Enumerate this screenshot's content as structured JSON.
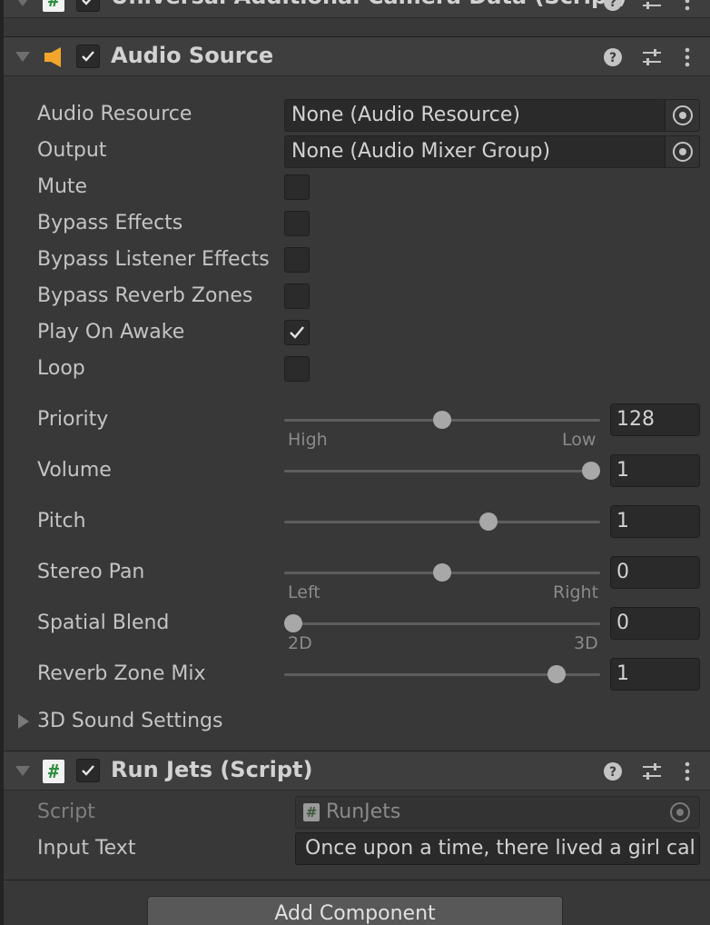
{
  "top_component": {
    "title": "Universal Additional Camera Data (Script)"
  },
  "audio_source": {
    "title": "Audio Source",
    "enabled": true,
    "fields": {
      "audio_resource": {
        "label": "Audio Resource",
        "value": "None (Audio Resource)"
      },
      "output": {
        "label": "Output",
        "value": "None (Audio Mixer Group)"
      }
    },
    "toggles": [
      {
        "label": "Mute",
        "checked": false
      },
      {
        "label": "Bypass Effects",
        "checked": false
      },
      {
        "label": "Bypass Listener Effects",
        "checked": false
      },
      {
        "label": "Bypass Reverb Zones",
        "checked": false
      },
      {
        "label": "Play On Awake",
        "checked": true
      },
      {
        "label": "Loop",
        "checked": false
      }
    ],
    "sliders": {
      "priority": {
        "label": "Priority",
        "value": "128",
        "fraction": 0.5,
        "min_label": "High",
        "max_label": "Low"
      },
      "volume": {
        "label": "Volume",
        "value": "1",
        "fraction": 1.0
      },
      "pitch": {
        "label": "Pitch",
        "value": "1",
        "fraction": 0.655
      },
      "stereo_pan": {
        "label": "Stereo Pan",
        "value": "0",
        "fraction": 0.5,
        "min_label": "Left",
        "max_label": "Right"
      },
      "spatial_blend": {
        "label": "Spatial Blend",
        "value": "0",
        "fraction": 0.0,
        "min_label": "2D",
        "max_label": "3D"
      },
      "reverb_zone_mix": {
        "label": "Reverb Zone Mix",
        "value": "1",
        "fraction": 0.885
      }
    },
    "sound_settings_label": "3D Sound Settings"
  },
  "run_jets": {
    "title": "Run Jets (Script)",
    "enabled": true,
    "script": {
      "label": "Script",
      "value": "RunJets"
    },
    "input_text": {
      "label": "Input Text",
      "value": "Once upon a time, there lived a girl cal"
    }
  },
  "add_component_label": "Add Component",
  "icons": {
    "help": "help-icon",
    "presets": "presets-icon",
    "menu": "kebab-menu-icon",
    "speaker": "speaker-icon",
    "script": "script-icon",
    "target": "object-picker-icon"
  },
  "colors": {
    "background": "#383838",
    "header": "#3e3e3e",
    "field": "#2a2a2a",
    "speaker_accent": "#f2a52a",
    "script_accent": "#2f8f3f"
  }
}
